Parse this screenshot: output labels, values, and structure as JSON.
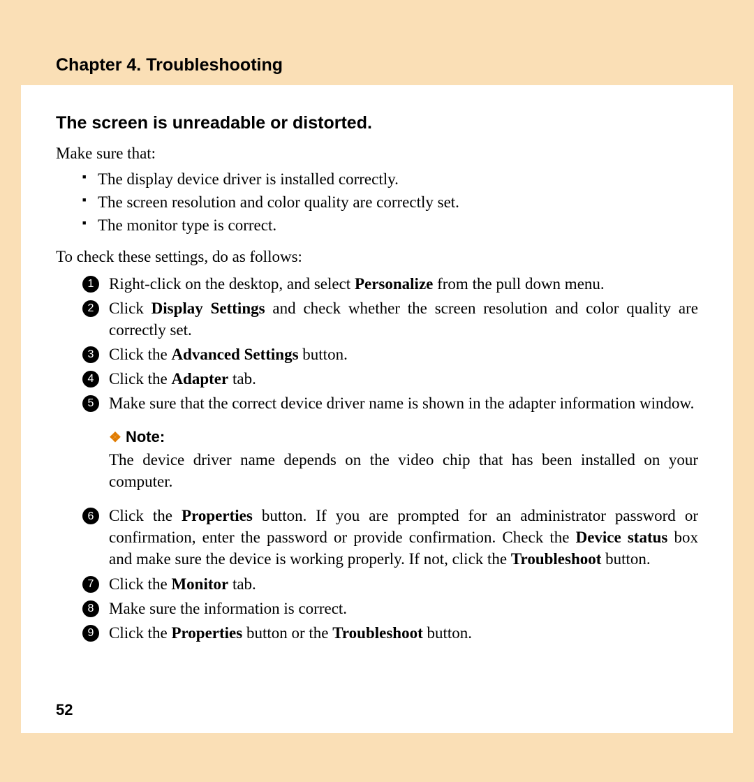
{
  "header": {
    "chapter": "Chapter 4. Troubleshooting"
  },
  "section": {
    "title": "The screen is unreadable or distorted.",
    "intro": "Make sure that:",
    "bullets": [
      "The display device driver is installed correctly.",
      "The screen resolution and color quality are correctly set.",
      "The monitor type is correct."
    ],
    "lead": "To check these settings, do as follows:"
  },
  "steps": [
    {
      "n": "1",
      "html": "Right-click on the desktop, and select <b>Personalize</b> from the pull down menu."
    },
    {
      "n": "2",
      "html": "Click <b>Display Settings</b> and check whether the screen resolution and color quality are correctly set."
    },
    {
      "n": "3",
      "html": "Click the <b>Advanced Settings</b> button."
    },
    {
      "n": "4",
      "html": "Click the <b>Adapter</b> tab."
    },
    {
      "n": "5",
      "html": "Make sure that the correct device driver name is shown in the adapter information window."
    }
  ],
  "note": {
    "label": "Note:",
    "body": "The device driver name depends on the video chip that has been installed on your computer."
  },
  "steps2": [
    {
      "n": "6",
      "html": "Click the <b>Properties</b> button. If you are prompted for an administrator password or confirmation, enter the password or provide confirmation. Check the <b>Device status</b> box and make sure the device is working properly. If not, click the <b>Troubleshoot</b> button."
    },
    {
      "n": "7",
      "html": "Click the <b>Monitor</b> tab."
    },
    {
      "n": "8",
      "html": "Make sure the information is correct."
    },
    {
      "n": "9",
      "html": "Click the <b>Properties</b> button or the <b>Troubleshoot</b> button."
    }
  ],
  "pagenum": "52"
}
